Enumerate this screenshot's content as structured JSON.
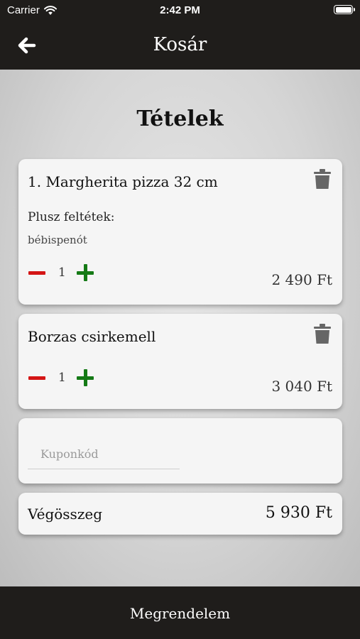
{
  "status_bar": {
    "carrier": "Carrier",
    "time": "2:42 PM"
  },
  "nav": {
    "title": "Kosár",
    "back_icon": "arrow-left-icon"
  },
  "section_title": "Tételek",
  "items": [
    {
      "name": "1. Margherita pizza 32 cm",
      "extras_label": "Plusz feltétek:",
      "extras": "bébispenót",
      "quantity": "1",
      "price": "2 490 Ft"
    },
    {
      "name": "Borzas csirkemell",
      "quantity": "1",
      "price": "3 040 Ft"
    }
  ],
  "coupon": {
    "placeholder": "Kuponkód",
    "value": ""
  },
  "total": {
    "label": "Végösszeg",
    "value": "5 930 Ft"
  },
  "order_button": {
    "label": "Megrendelem"
  },
  "colors": {
    "bar": "#1f1d1b",
    "minus": "#d41515",
    "plus": "#157a16",
    "card": "#f5f5f5"
  }
}
